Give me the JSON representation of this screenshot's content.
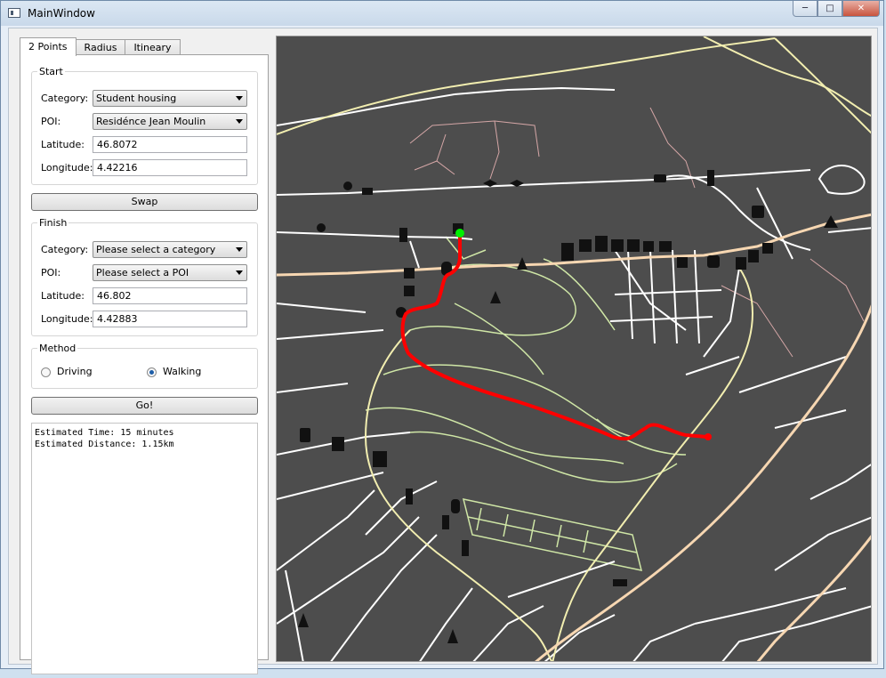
{
  "window": {
    "title": "MainWindow"
  },
  "tabs": [
    "2 Points",
    "Radius",
    "Itineary"
  ],
  "start": {
    "group_title": "Start",
    "category_label": "Category:",
    "category_value": "Student housing",
    "poi_label": "POI:",
    "poi_value": "Residénce Jean Moulin",
    "latitude_label": "Latitude:",
    "latitude_value": "46.8072",
    "longitude_label": "Longitude:",
    "longitude_value": "4.42216"
  },
  "swap_label": "Swap",
  "finish": {
    "group_title": "Finish",
    "category_label": "Category:",
    "category_value": "Please select a category",
    "poi_label": "POI:",
    "poi_value": "Please select a POI",
    "latitude_label": "Latitude:",
    "latitude_value": "46.802",
    "longitude_label": "Longitude:",
    "longitude_value": "4.42883"
  },
  "method": {
    "group_title": "Method",
    "options": [
      "Driving",
      "Walking"
    ],
    "selected": "Walking"
  },
  "go_label": "Go!",
  "output": {
    "time": "Estimated Time: 15 minutes",
    "distance": "Estimated Distance: 1.15km"
  },
  "map": {
    "colors": {
      "background": "#4d4d4d",
      "road": "#ffffff",
      "major_road": "#f7d7b2",
      "secondary_road": "#f2eeb0",
      "park_path": "#cfe6a6",
      "footpath": "#d4a6a6",
      "route": "#ff0000",
      "start_marker": "#00ee00"
    }
  }
}
